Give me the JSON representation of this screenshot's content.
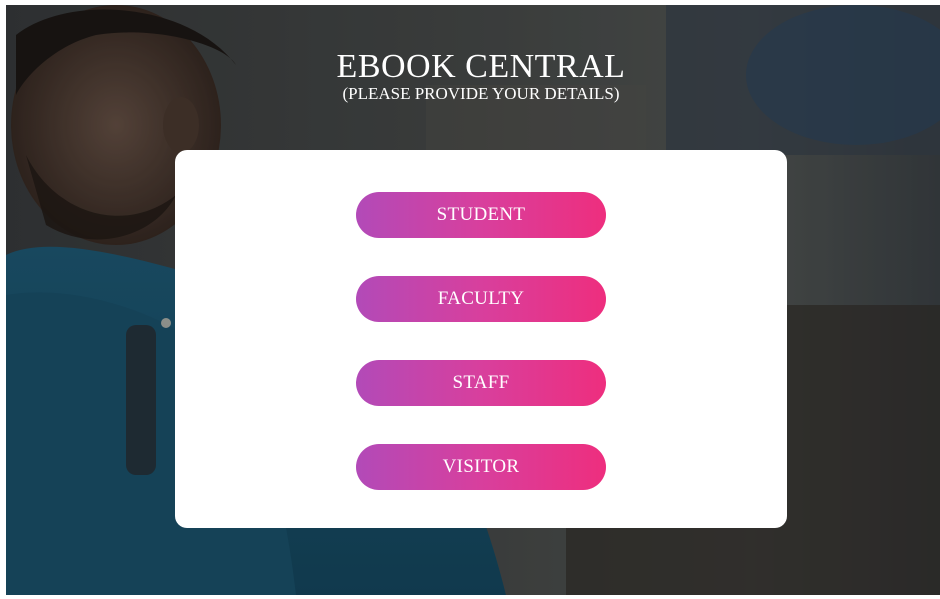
{
  "page": {
    "title": "EBOOK CENTRAL",
    "subtitle": "(PLEASE PROVIDE YOUR DETAILS)"
  },
  "background": {
    "description_icon": "student-photo-image"
  },
  "roles": [
    {
      "label": "STUDENT"
    },
    {
      "label": "FACULTY"
    },
    {
      "label": "STAFF"
    },
    {
      "label": "VISITOR"
    }
  ],
  "colors": {
    "button_gradient_start": "#b24ab8",
    "button_gradient_end": "#ee2e7e",
    "card": "#ffffff",
    "overlay": "#2f3438"
  }
}
